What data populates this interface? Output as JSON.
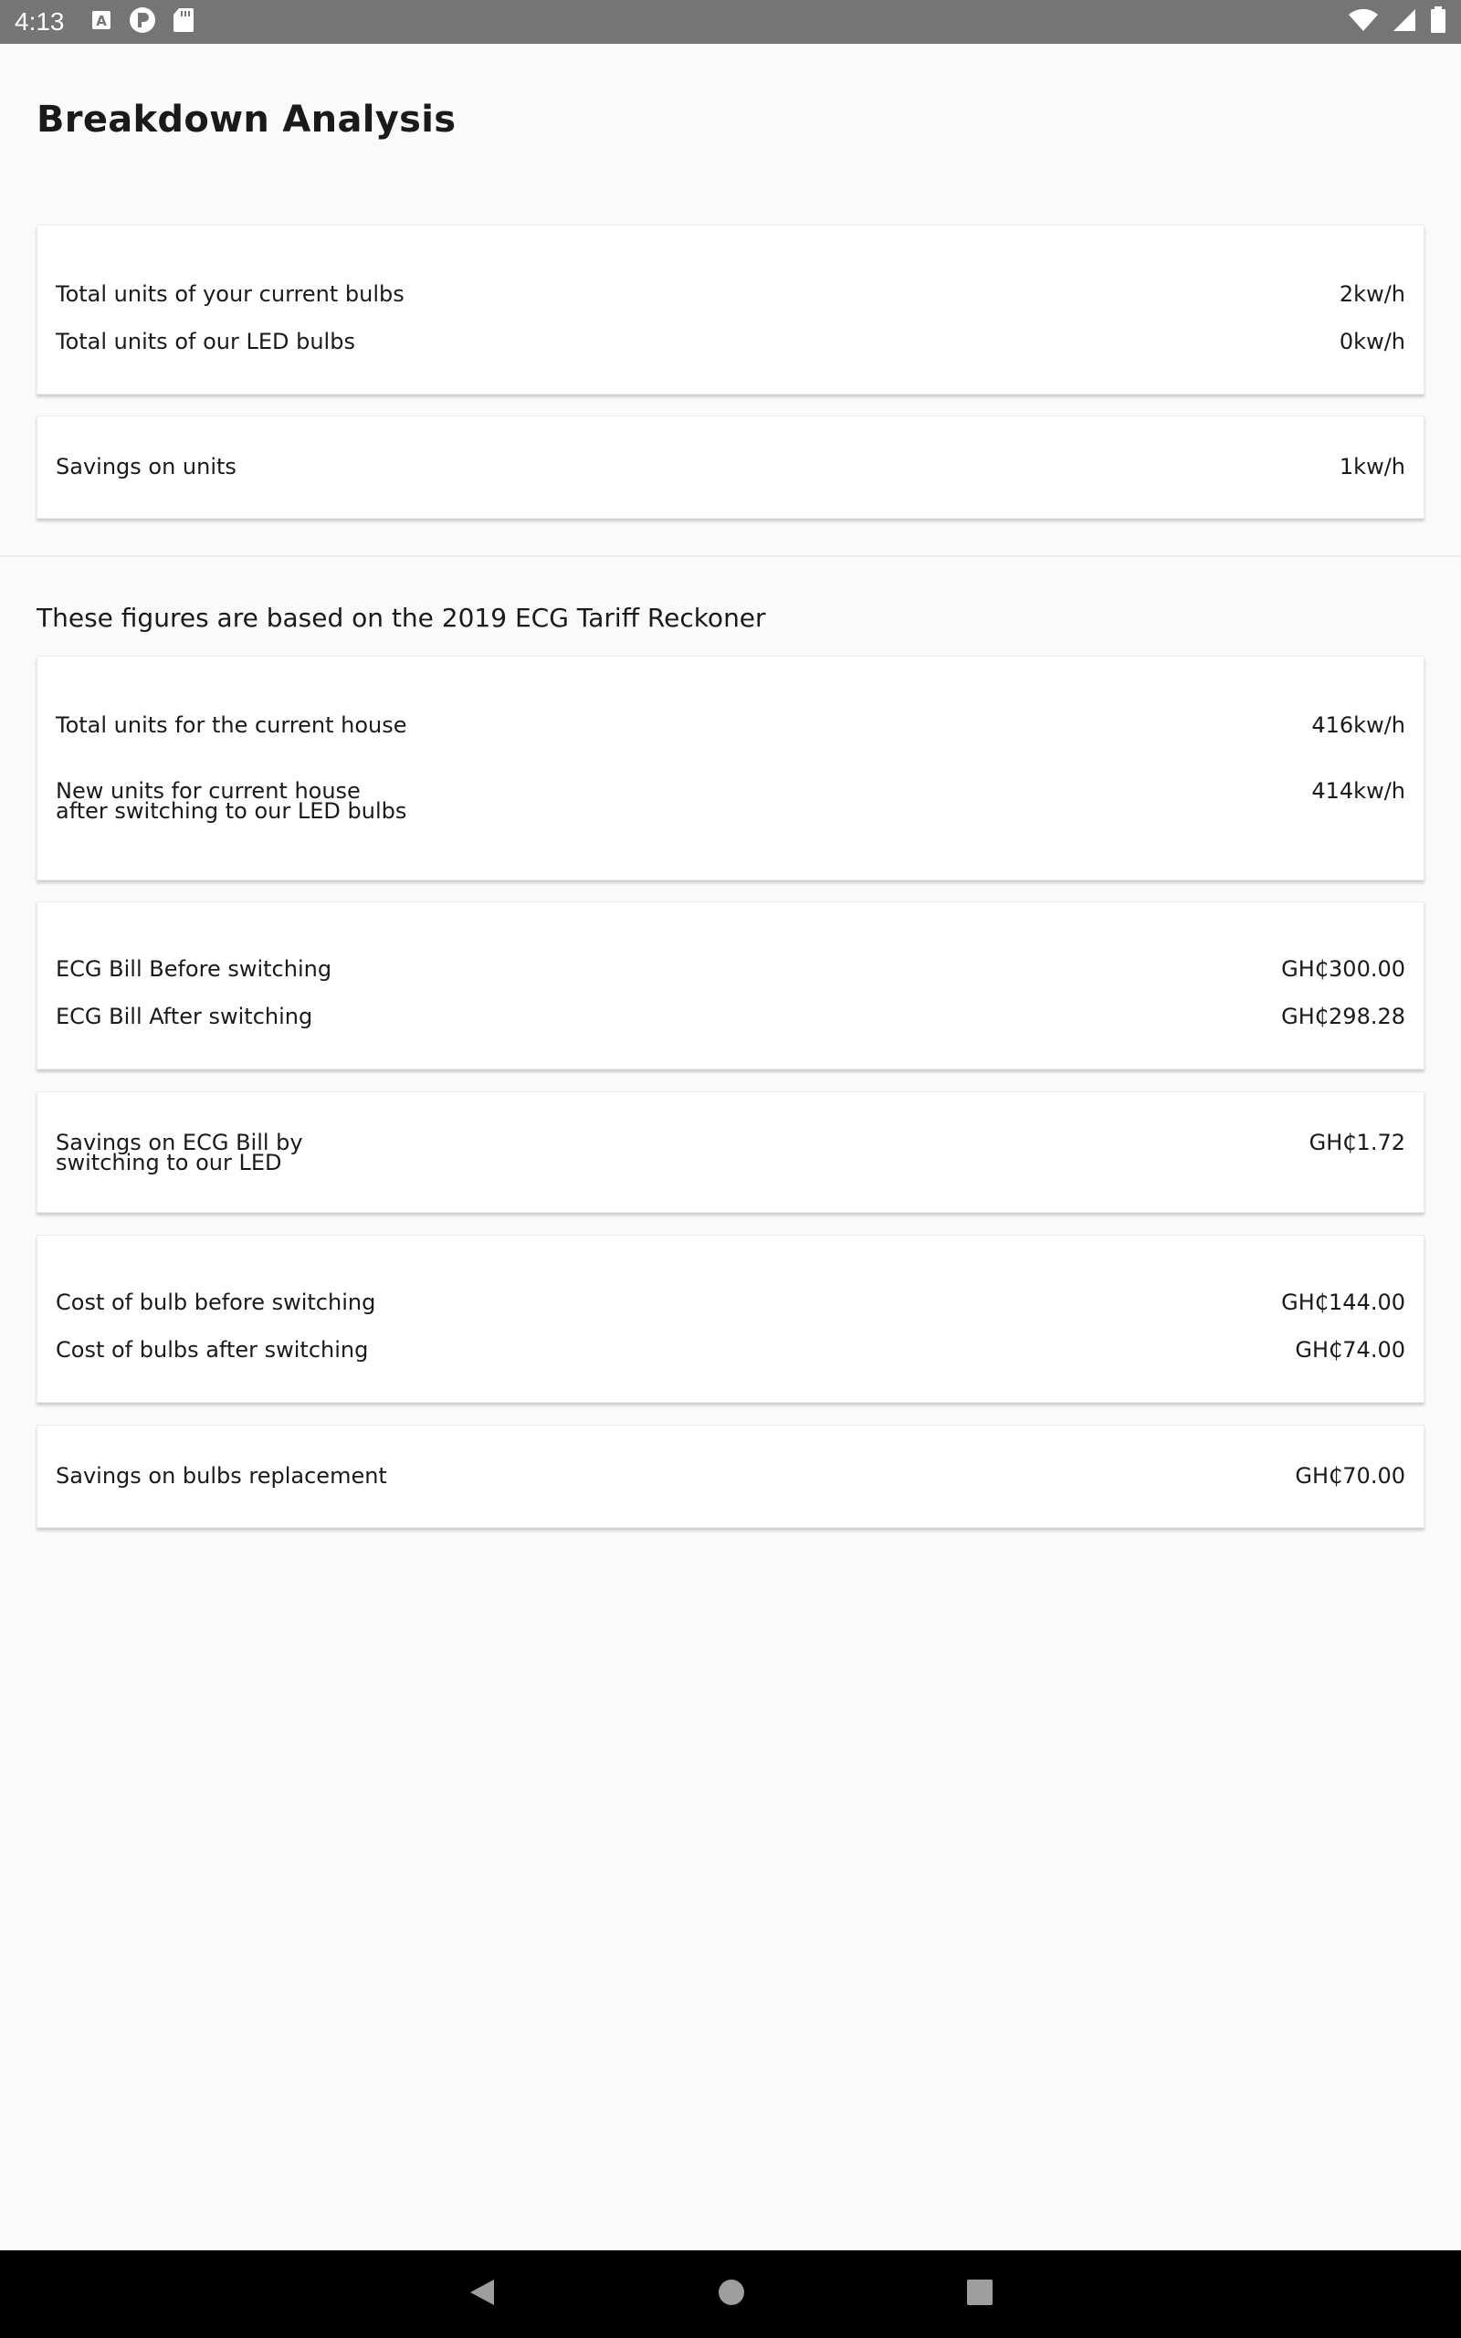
{
  "status_bar": {
    "time": "4:13",
    "left_icons": [
      "a-notification-icon",
      "p-notification-icon",
      "sd-card-icon"
    ],
    "right_icons": [
      "wifi-icon",
      "cell-signal-icon",
      "battery-icon"
    ]
  },
  "page": {
    "title": "Breakdown Analysis",
    "section_note": "These figures are based on the 2019 ECG Tariff Reckoner"
  },
  "cards": {
    "bulb_units": {
      "rows": [
        {
          "label": "Total units of your current bulbs",
          "value": "2kw/h"
        },
        {
          "label": "Total units of our LED bulbs",
          "value": "0kw/h"
        }
      ]
    },
    "unit_savings": {
      "rows": [
        {
          "label": "Savings on units",
          "value": "1kw/h"
        }
      ]
    },
    "house_units": {
      "rows": [
        {
          "label": "Total units for the current house",
          "value": "416kw/h"
        },
        {
          "label": "New units for current house\nafter switching to our LED bulbs",
          "value": "414kw/h"
        }
      ]
    },
    "ecg_bill": {
      "rows": [
        {
          "label": "ECG Bill Before switching",
          "value": "GH₵300.00"
        },
        {
          "label": "ECG Bill After switching",
          "value": "GH₵298.28"
        }
      ]
    },
    "bill_savings": {
      "rows": [
        {
          "label": "Savings on ECG Bill by\nswitching to our LED",
          "value": "GH₵1.72"
        }
      ]
    },
    "bulb_cost": {
      "rows": [
        {
          "label": "Cost of bulb before switching",
          "value": "GH₵144.00"
        },
        {
          "label": "Cost of bulbs after switching",
          "value": "GH₵74.00"
        }
      ]
    },
    "replacement_savings": {
      "rows": [
        {
          "label": "Savings on bulbs replacement",
          "value": "GH₵70.00"
        }
      ]
    }
  },
  "nav_bar": {
    "buttons": [
      "back-icon",
      "home-icon",
      "recents-icon"
    ]
  },
  "colors": {
    "status_bar": "#757575",
    "background": "#fafafa",
    "card": "#ffffff",
    "nav_bar": "#000000"
  }
}
